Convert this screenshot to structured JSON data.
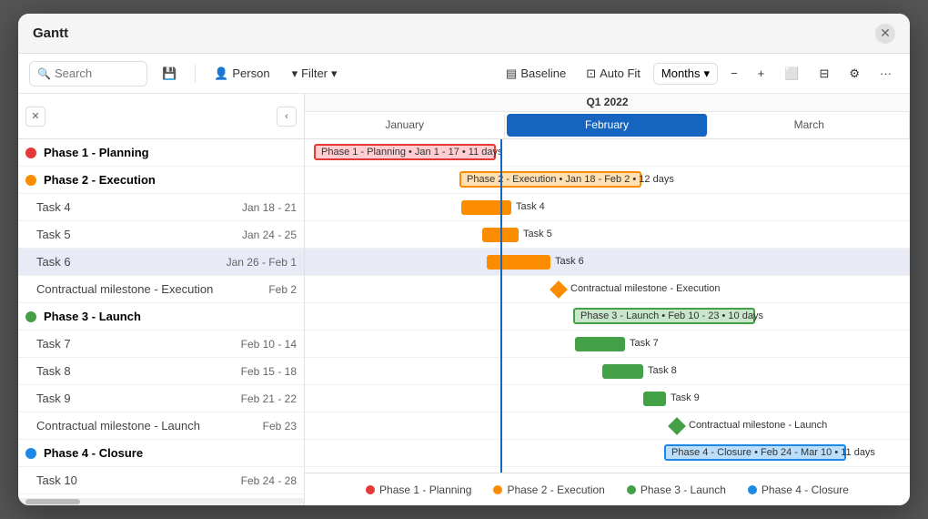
{
  "window": {
    "title": "Gantt",
    "close_label": "✕"
  },
  "toolbar": {
    "search_placeholder": "Search",
    "person_label": "Person",
    "filter_label": "Filter",
    "baseline_label": "Baseline",
    "autofit_label": "Auto Fit",
    "months_label": "Months",
    "zoom_in": "+",
    "zoom_out": "−"
  },
  "quarter": "Q1 2022",
  "months": [
    "January",
    "February",
    "March"
  ],
  "active_month": "February",
  "phases": [
    {
      "id": "phase1",
      "label": "Phase 1 - Planning",
      "color": "#e53935"
    },
    {
      "id": "phase2",
      "label": "Phase 2 - Execution",
      "color": "#fb8c00"
    },
    {
      "id": "phase3",
      "label": "Phase 3 - Launch",
      "color": "#43a047"
    },
    {
      "id": "phase4",
      "label": "Phase 4 - Closure",
      "color": "#1e88e5"
    }
  ],
  "tasks": [
    {
      "id": "phase1",
      "label": "Phase 1 - Planning",
      "type": "phase",
      "phase": 1
    },
    {
      "id": "phase2",
      "label": "Phase 2 - Execution",
      "type": "phase",
      "phase": 2
    },
    {
      "id": "task4",
      "label": "Task 4",
      "date": "Jan 18 - 21",
      "type": "task"
    },
    {
      "id": "task5",
      "label": "Task 5",
      "date": "Jan 24 - 25",
      "type": "task"
    },
    {
      "id": "task6",
      "label": "Task 6",
      "date": "Jan 26 - Feb 1",
      "type": "task",
      "highlight": true
    },
    {
      "id": "milestone_exec",
      "label": "Contractual milestone - Execution",
      "date": "Feb 2",
      "type": "milestone"
    },
    {
      "id": "phase3",
      "label": "Phase 3 - Launch",
      "type": "phase",
      "phase": 3
    },
    {
      "id": "task7",
      "label": "Task 7",
      "date": "Feb 10 - 14",
      "type": "task"
    },
    {
      "id": "task8",
      "label": "Task 8",
      "date": "Feb 15 - 18",
      "type": "task"
    },
    {
      "id": "task9",
      "label": "Task 9",
      "date": "Feb 21 - 22",
      "type": "task"
    },
    {
      "id": "milestone_launch",
      "label": "Contractual milestone - Launch",
      "date": "Feb 23",
      "type": "milestone"
    },
    {
      "id": "phase4",
      "label": "Phase 4 - Closure",
      "type": "phase",
      "phase": 4
    },
    {
      "id": "task10",
      "label": "Task 10",
      "date": "Feb 24 - 28",
      "type": "task"
    }
  ],
  "legend": [
    {
      "label": "Phase 1 - Planning",
      "color": "#e53935"
    },
    {
      "label": "Phase 2 - Execution",
      "color": "#fb8c00"
    },
    {
      "label": "Phase 3 - Launch",
      "color": "#43a047"
    },
    {
      "label": "Phase 4 - Closure",
      "color": "#1e88e5"
    }
  ]
}
